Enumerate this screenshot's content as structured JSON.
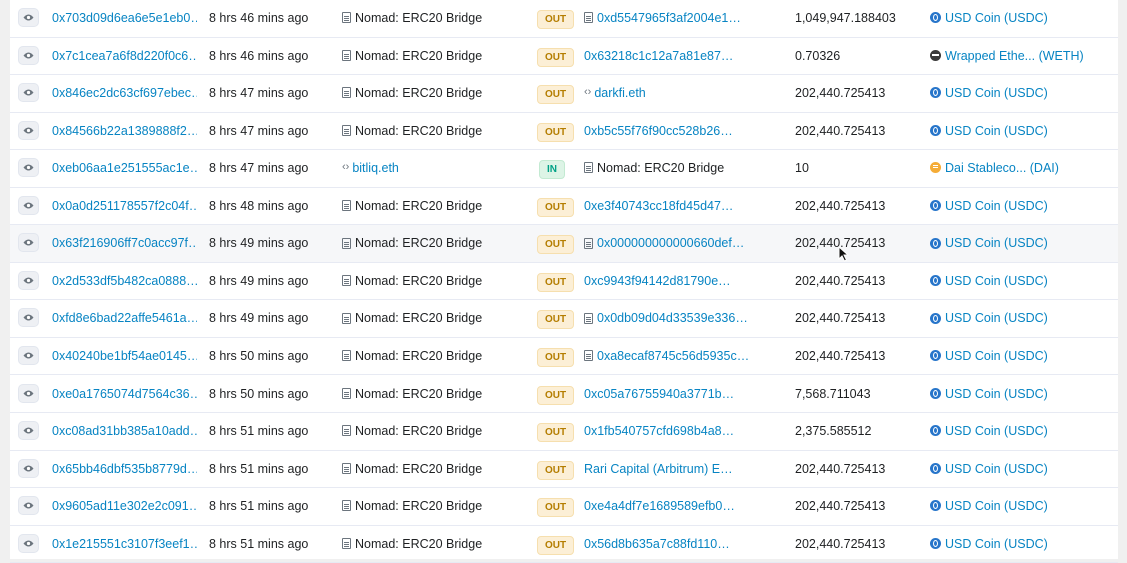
{
  "rows": [
    {
      "hash": "0x703d09d6ea6e5e1eb0…",
      "age": "8 hrs 46 mins ago",
      "from": "Nomad: ERC20 Bridge",
      "from_type": "contract",
      "dir": "OUT",
      "to": "0xd5547965f3af2004e1…",
      "to_type": "contract",
      "value": "1,049,947.188403",
      "token": "USD Coin (USDC)",
      "token_icon": "usdc-icon"
    },
    {
      "hash": "0x7c1cea7a6f8d220f0c6…",
      "age": "8 hrs 46 mins ago",
      "from": "Nomad: ERC20 Bridge",
      "from_type": "contract",
      "dir": "OUT",
      "to": "0x63218c1c12a7a81e87…",
      "to_type": "address",
      "value": "0.70326",
      "token": "Wrapped Ethe... (WETH)",
      "token_icon": "weth-icon"
    },
    {
      "hash": "0x846ec2dc63cf697ebec…",
      "age": "8 hrs 47 mins ago",
      "from": "Nomad: ERC20 Bridge",
      "from_type": "contract",
      "dir": "OUT",
      "to": "darkfi.eth",
      "to_type": "ens",
      "value": "202,440.725413",
      "token": "USD Coin (USDC)",
      "token_icon": "usdc-icon"
    },
    {
      "hash": "0x84566b22a1389888f2…",
      "age": "8 hrs 47 mins ago",
      "from": "Nomad: ERC20 Bridge",
      "from_type": "contract",
      "dir": "OUT",
      "to": "0xb5c55f76f90cc528b26…",
      "to_type": "address",
      "value": "202,440.725413",
      "token": "USD Coin (USDC)",
      "token_icon": "usdc-icon"
    },
    {
      "hash": "0xeb06aa1e251555ac1e…",
      "age": "8 hrs 47 mins ago",
      "from": "bitliq.eth",
      "from_type": "ens",
      "dir": "IN",
      "to": "Nomad: ERC20 Bridge",
      "to_type": "contract-plain",
      "value": "10",
      "token": "Dai Stableco... (DAI)",
      "token_icon": "dai-icon"
    },
    {
      "hash": "0x0a0d251178557f2c04f…",
      "age": "8 hrs 48 mins ago",
      "from": "Nomad: ERC20 Bridge",
      "from_type": "contract",
      "dir": "OUT",
      "to": "0xe3f40743cc18fd45d47…",
      "to_type": "address",
      "value": "202,440.725413",
      "token": "USD Coin (USDC)",
      "token_icon": "usdc-icon"
    },
    {
      "hash": "0x63f216906ff7c0acc97f…",
      "age": "8 hrs 49 mins ago",
      "from": "Nomad: ERC20 Bridge",
      "from_type": "contract",
      "dir": "OUT",
      "to": "0x000000000000660def…",
      "to_type": "contract",
      "value": "202,440.725413",
      "token": "USD Coin (USDC)",
      "token_icon": "usdc-icon"
    },
    {
      "hash": "0x2d533df5b482ca0888…",
      "age": "8 hrs 49 mins ago",
      "from": "Nomad: ERC20 Bridge",
      "from_type": "contract",
      "dir": "OUT",
      "to": "0xc9943f94142d81790e…",
      "to_type": "address",
      "value": "202,440.725413",
      "token": "USD Coin (USDC)",
      "token_icon": "usdc-icon"
    },
    {
      "hash": "0xfd8e6bad22affe5461a…",
      "age": "8 hrs 49 mins ago",
      "from": "Nomad: ERC20 Bridge",
      "from_type": "contract",
      "dir": "OUT",
      "to": "0x0db09d04d33539e336…",
      "to_type": "contract",
      "value": "202,440.725413",
      "token": "USD Coin (USDC)",
      "token_icon": "usdc-icon"
    },
    {
      "hash": "0x40240be1bf54ae0145…",
      "age": "8 hrs 50 mins ago",
      "from": "Nomad: ERC20 Bridge",
      "from_type": "contract",
      "dir": "OUT",
      "to": "0xa8ecaf8745c56d5935c…",
      "to_type": "contract",
      "value": "202,440.725413",
      "token": "USD Coin (USDC)",
      "token_icon": "usdc-icon"
    },
    {
      "hash": "0xe0a1765074d7564c36…",
      "age": "8 hrs 50 mins ago",
      "from": "Nomad: ERC20 Bridge",
      "from_type": "contract",
      "dir": "OUT",
      "to": "0xc05a76755940a3771b…",
      "to_type": "address",
      "value": "7,568.711043",
      "token": "USD Coin (USDC)",
      "token_icon": "usdc-icon"
    },
    {
      "hash": "0xc08ad31bb385a10add…",
      "age": "8 hrs 51 mins ago",
      "from": "Nomad: ERC20 Bridge",
      "from_type": "contract",
      "dir": "OUT",
      "to": "0x1fb540757cfd698b4a8…",
      "to_type": "address",
      "value": "2,375.585512",
      "token": "USD Coin (USDC)",
      "token_icon": "usdc-icon"
    },
    {
      "hash": "0x65bb46dbf535b8779d…",
      "age": "8 hrs 51 mins ago",
      "from": "Nomad: ERC20 Bridge",
      "from_type": "contract",
      "dir": "OUT",
      "to": "Rari Capital (Arbitrum) E…",
      "to_type": "address",
      "value": "202,440.725413",
      "token": "USD Coin (USDC)",
      "token_icon": "usdc-icon"
    },
    {
      "hash": "0x9605ad11e302e2c091…",
      "age": "8 hrs 51 mins ago",
      "from": "Nomad: ERC20 Bridge",
      "from_type": "contract",
      "dir": "OUT",
      "to": "0xe4a4df7e1689589efb0…",
      "to_type": "address",
      "value": "202,440.725413",
      "token": "USD Coin (USDC)",
      "token_icon": "usdc-icon"
    },
    {
      "hash": "0x1e215551c3107f3eef1…",
      "age": "8 hrs 51 mins ago",
      "from": "Nomad: ERC20 Bridge",
      "from_type": "contract",
      "dir": "OUT",
      "to": "0x56d8b635a7c88fd110…",
      "to_type": "address",
      "value": "202,440.725413",
      "token": "USD Coin (USDC)",
      "token_icon": "usdc-icon"
    }
  ],
  "hover_row": 6,
  "colors": {
    "link": "#0784c3",
    "out_badge_bg": "#fcefd6",
    "out_badge_text": "#b47d00",
    "in_badge_bg": "#ddf4e6",
    "in_badge_text": "#00a186"
  }
}
